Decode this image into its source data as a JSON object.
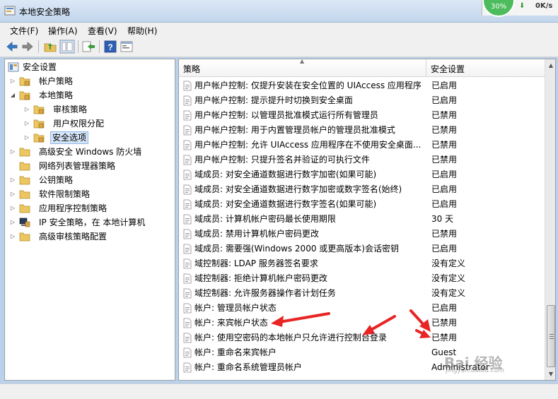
{
  "window": {
    "title": "本地安全策略",
    "net_percent": "30%",
    "net_speed": "0K/s"
  },
  "menu": [
    "文件(F)",
    "操作(A)",
    "查看(V)",
    "帮助(H)"
  ],
  "tree": {
    "root": "安全设置",
    "items": [
      {
        "label": "帐户策略",
        "expander": "▷"
      },
      {
        "label": "本地策略",
        "expander": "◢"
      },
      {
        "label": "审核策略",
        "expander": "▷"
      },
      {
        "label": "用户权限分配",
        "expander": "▷"
      },
      {
        "label": "安全选项",
        "expander": "▷"
      },
      {
        "label": "高级安全 Windows 防火墙",
        "expander": "▷"
      },
      {
        "label": "网络列表管理器策略",
        "expander": ""
      },
      {
        "label": "公钥策略",
        "expander": "▷"
      },
      {
        "label": "软件限制策略",
        "expander": "▷"
      },
      {
        "label": "应用程序控制策略",
        "expander": "▷"
      },
      {
        "label": "IP 安全策略，在 本地计算机",
        "expander": "▷"
      },
      {
        "label": "高级审核策略配置",
        "expander": "▷"
      }
    ]
  },
  "list": {
    "headers": {
      "policy": "策略",
      "setting": "安全设置"
    },
    "rows": [
      {
        "name": "用户帐户控制: 仅提升安装在安全位置的 UIAccess 应用程序",
        "value": "已启用"
      },
      {
        "name": "用户帐户控制: 提示提升时切换到安全桌面",
        "value": "已启用"
      },
      {
        "name": "用户帐户控制: 以管理员批准模式运行所有管理员",
        "value": "已禁用"
      },
      {
        "name": "用户帐户控制: 用于内置管理员帐户的管理员批准模式",
        "value": "已禁用"
      },
      {
        "name": "用户帐户控制: 允许 UIAccess 应用程序在不使用安全桌面...",
        "value": "已禁用"
      },
      {
        "name": "用户帐户控制: 只提升签名并验证的可执行文件",
        "value": "已禁用"
      },
      {
        "name": "域成员: 对安全通道数据进行数字加密(如果可能)",
        "value": "已启用"
      },
      {
        "name": "域成员: 对安全通道数据进行数字加密或数字签名(始终)",
        "value": "已启用"
      },
      {
        "name": "域成员: 对安全通道数据进行数字签名(如果可能)",
        "value": "已启用"
      },
      {
        "name": "域成员: 计算机帐户密码最长使用期限",
        "value": "30 天"
      },
      {
        "name": "域成员: 禁用计算机帐户密码更改",
        "value": "已禁用"
      },
      {
        "name": "域成员: 需要强(Windows 2000 或更高版本)会话密钥",
        "value": "已启用"
      },
      {
        "name": "域控制器: LDAP 服务器签名要求",
        "value": "没有定义"
      },
      {
        "name": "域控制器: 拒绝计算机帐户密码更改",
        "value": "没有定义"
      },
      {
        "name": "域控制器: 允许服务器操作者计划任务",
        "value": "没有定义"
      },
      {
        "name": "帐户: 管理员帐户状态",
        "value": "已启用"
      },
      {
        "name": "帐户: 来宾帐户状态",
        "value": "已禁用"
      },
      {
        "name": "帐户: 使用空密码的本地帐户只允许进行控制台登录",
        "value": "已禁用"
      },
      {
        "name": "帐户: 重命名来宾帐户",
        "value": "Guest"
      },
      {
        "name": "帐户: 重命名系统管理员帐户",
        "value": "Administrator"
      }
    ]
  },
  "watermark": {
    "text": "Bai 经验",
    "sub": "jingyan.baidu.com"
  },
  "colors": {
    "annotation_red": "#e82424",
    "selection": "#d5e5f8"
  }
}
